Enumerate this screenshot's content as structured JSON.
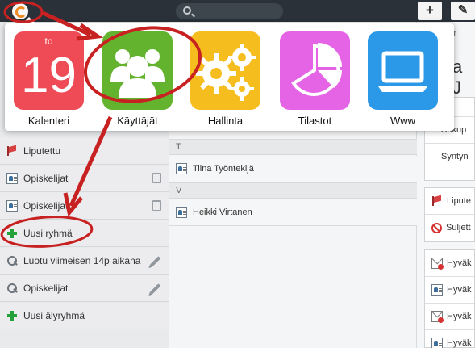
{
  "header": {
    "plus_label": "+",
    "pencil_label": "✎"
  },
  "launcher": {
    "apps": [
      {
        "label": "Kalenteri",
        "icon": "calendar-icon",
        "day": "to",
        "date": "19",
        "color": "#ef4b57"
      },
      {
        "label": "Käyttäjät",
        "icon": "users-icon",
        "color": "#63b32e"
      },
      {
        "label": "Hallinta",
        "icon": "gears-icon",
        "color": "#f5bd1d"
      },
      {
        "label": "Tilastot",
        "icon": "pie-chart-icon",
        "color": "#e564e6"
      },
      {
        "label": "Www",
        "icon": "laptop-icon",
        "color": "#2c98e8"
      }
    ]
  },
  "left_list": [
    {
      "label": "Liputettu",
      "icon": "flag-icon"
    },
    {
      "label": "Opiskelijat",
      "icon": "card-icon"
    },
    {
      "label": "Opiskelijat",
      "icon": "card-icon"
    },
    {
      "label": "Uusi ryhmä",
      "icon": "plus-icon"
    },
    {
      "label": "Luotu viimeisen 14p aikana",
      "icon": "magnifier-icon"
    },
    {
      "label": "Opiskelijat",
      "icon": "magnifier-icon"
    },
    {
      "label": "Uusi älyryhmä",
      "icon": "plus-icon"
    }
  ],
  "middle_list": {
    "sections": [
      {
        "letter": "T",
        "person": "Tiina Työntekijä"
      },
      {
        "letter": "V",
        "person": "Heikki Virtanen"
      }
    ]
  },
  "right_panel": {
    "heading_fragment": "ot",
    "name_fragment": "a J",
    "meta_fragment": "ähkö",
    "fields": [
      "Sukup",
      "Syntyn"
    ],
    "status_items": [
      "Lipute",
      "Suljett"
    ],
    "message_items": [
      "Hyväk",
      "Hyväk",
      "Hyväk",
      "Hyväk"
    ]
  }
}
